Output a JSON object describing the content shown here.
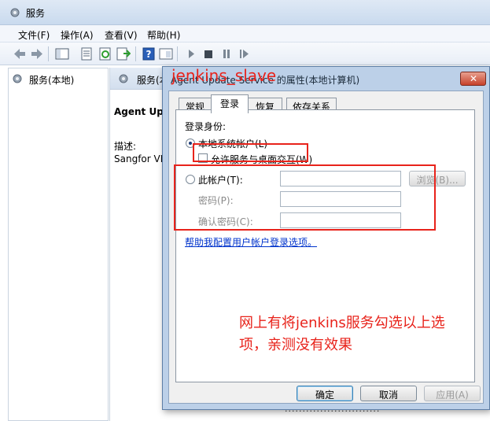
{
  "window": {
    "title": "服务"
  },
  "menu": [
    "文件(F)",
    "操作(A)",
    "查看(V)",
    "帮助(H)"
  ],
  "tree": {
    "root_label": "服务(本地)"
  },
  "panel": {
    "header": "服务(本地)",
    "service_name": "Agent Upc",
    "description_label": "描述:",
    "description_value": "Sangfor VI"
  },
  "background_text": "...........................",
  "dialog": {
    "title": "Agent Update Service 的属性(本地计算机)",
    "tabs": [
      "常规",
      "登录",
      "恢复",
      "依存关系"
    ],
    "active_tab": "登录",
    "logon_as_label": "登录身份:",
    "local_system_label": "本地系统帐户(L)",
    "allow_desktop_label": "允许服务与桌面交互(W)",
    "this_account_label": "此帐户(T):",
    "browse_label": "浏览(B)...",
    "password_label": "密码(P):",
    "confirm_password_label": "确认密码(C):",
    "help_link": "帮助我配置用户帐户登录选项。",
    "ok_label": "确定",
    "cancel_label": "取消",
    "apply_label": "应用(A)"
  },
  "annotations": {
    "overlay_title": "jenkins_slave",
    "note_line1": "网上有将jenkins服务勾选以上选",
    "note_line2": "项，亲测没有效果"
  },
  "colors": {
    "annotation": "#e8231b",
    "link": "#0033cc",
    "dialog_frame": "#bcd0e8"
  }
}
